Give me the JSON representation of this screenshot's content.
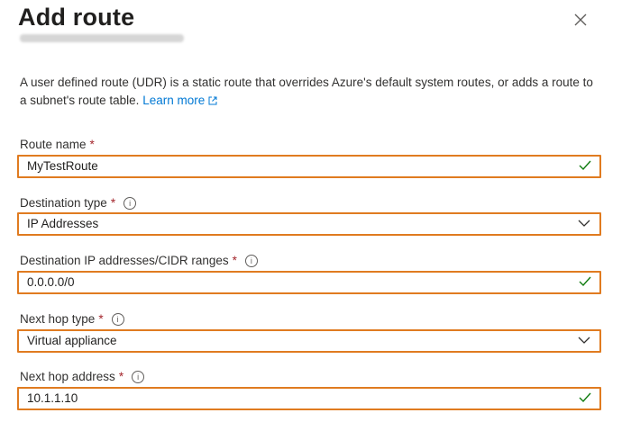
{
  "panel": {
    "title": "Add route",
    "description": "A user defined route (UDR) is a static route that overrides Azure's default system routes, or adds a route to a subnet's route table.",
    "learn_more": "Learn more"
  },
  "fields": {
    "route_name": {
      "label": "Route name",
      "value": "MyTestRoute",
      "required": "*"
    },
    "destination_type": {
      "label": "Destination type",
      "value": "IP Addresses",
      "required": "*"
    },
    "destination_ips": {
      "label": "Destination IP addresses/CIDR ranges",
      "value": "0.0.0.0/0",
      "required": "*"
    },
    "next_hop_type": {
      "label": "Next hop type",
      "value": "Virtual appliance",
      "required": "*"
    },
    "next_hop_address": {
      "label": "Next hop address",
      "value": "10.1.1.10",
      "required": "*"
    }
  },
  "icons": {
    "close": "close-icon",
    "info": "info-icon",
    "check": "checkmark-icon",
    "chevron": "chevron-down-icon",
    "external": "external-link-icon"
  },
  "colors": {
    "highlight_border": "#e07b20",
    "link": "#0078d4",
    "required": "#a4262c",
    "valid_check": "#107c10"
  }
}
